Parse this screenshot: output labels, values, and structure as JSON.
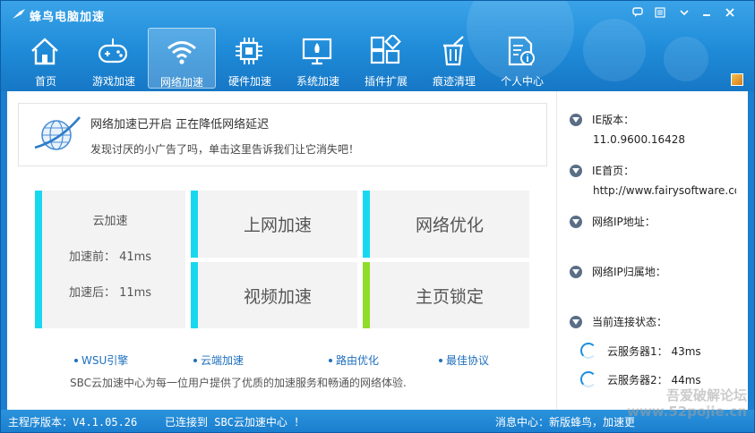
{
  "window": {
    "title": "蜂鸟电脑加速"
  },
  "nav": {
    "items": [
      {
        "label": "首页",
        "icon": "home-icon"
      },
      {
        "label": "游戏加速",
        "icon": "gamepad-icon"
      },
      {
        "label": "网络加速",
        "icon": "wifi-icon",
        "active": true
      },
      {
        "label": "硬件加速",
        "icon": "chip-icon"
      },
      {
        "label": "系统加速",
        "icon": "monitor-rocket-icon"
      },
      {
        "label": "插件扩展",
        "icon": "puzzle-icon"
      },
      {
        "label": "痕迹清理",
        "icon": "trash-broom-icon"
      },
      {
        "label": "个人中心",
        "icon": "profile-doc-icon"
      }
    ]
  },
  "notice": {
    "title": "网络加速已开启 正在降低网络延迟",
    "subtitle": "发现讨厌的小广告了吗，单击这里告诉我们让它消失吧！"
  },
  "cloud": {
    "title": "云加速",
    "before": "加速前： 41ms",
    "after": "加速后： 11ms"
  },
  "tiles": {
    "internet_speedup": "上网加速",
    "network_optimize": "网络优化",
    "video_speedup": "视频加速",
    "homepage_lock": "主页锁定"
  },
  "links": [
    "WSU引擎",
    "云端加速",
    "路由优化",
    "最佳协议"
  ],
  "description": "SBC云加速中心为每一位用户提供了优质的加速服务和畅通的网络体验.",
  "info": {
    "ie_version_label": "IE版本：",
    "ie_version_value": "11.0.9600.16428",
    "ie_homepage_label": "IE首页：",
    "ie_homepage_value": "http://www.fairysoftware.com",
    "ip_label": "网络IP地址：",
    "ip_location_label": "网络IP归属地：",
    "connection_label": "当前连接状态：",
    "servers": [
      "云服务器1： 43ms",
      "云服务器2： 44ms"
    ]
  },
  "status": {
    "version": "主程序版本：V4.1.05.26",
    "connection": "已连接到 SBC云加速中心 ！",
    "messages": "消息中心：新版蜂鸟，加速更"
  },
  "watermark": [
    "吾爱破解论坛",
    "www.52pojie.cn"
  ],
  "colors": {
    "accent": "#1f8bd8",
    "tile_bar": "#18d8f0",
    "tile_bar_green": "#90dc2a",
    "link": "#1d6fbd"
  }
}
